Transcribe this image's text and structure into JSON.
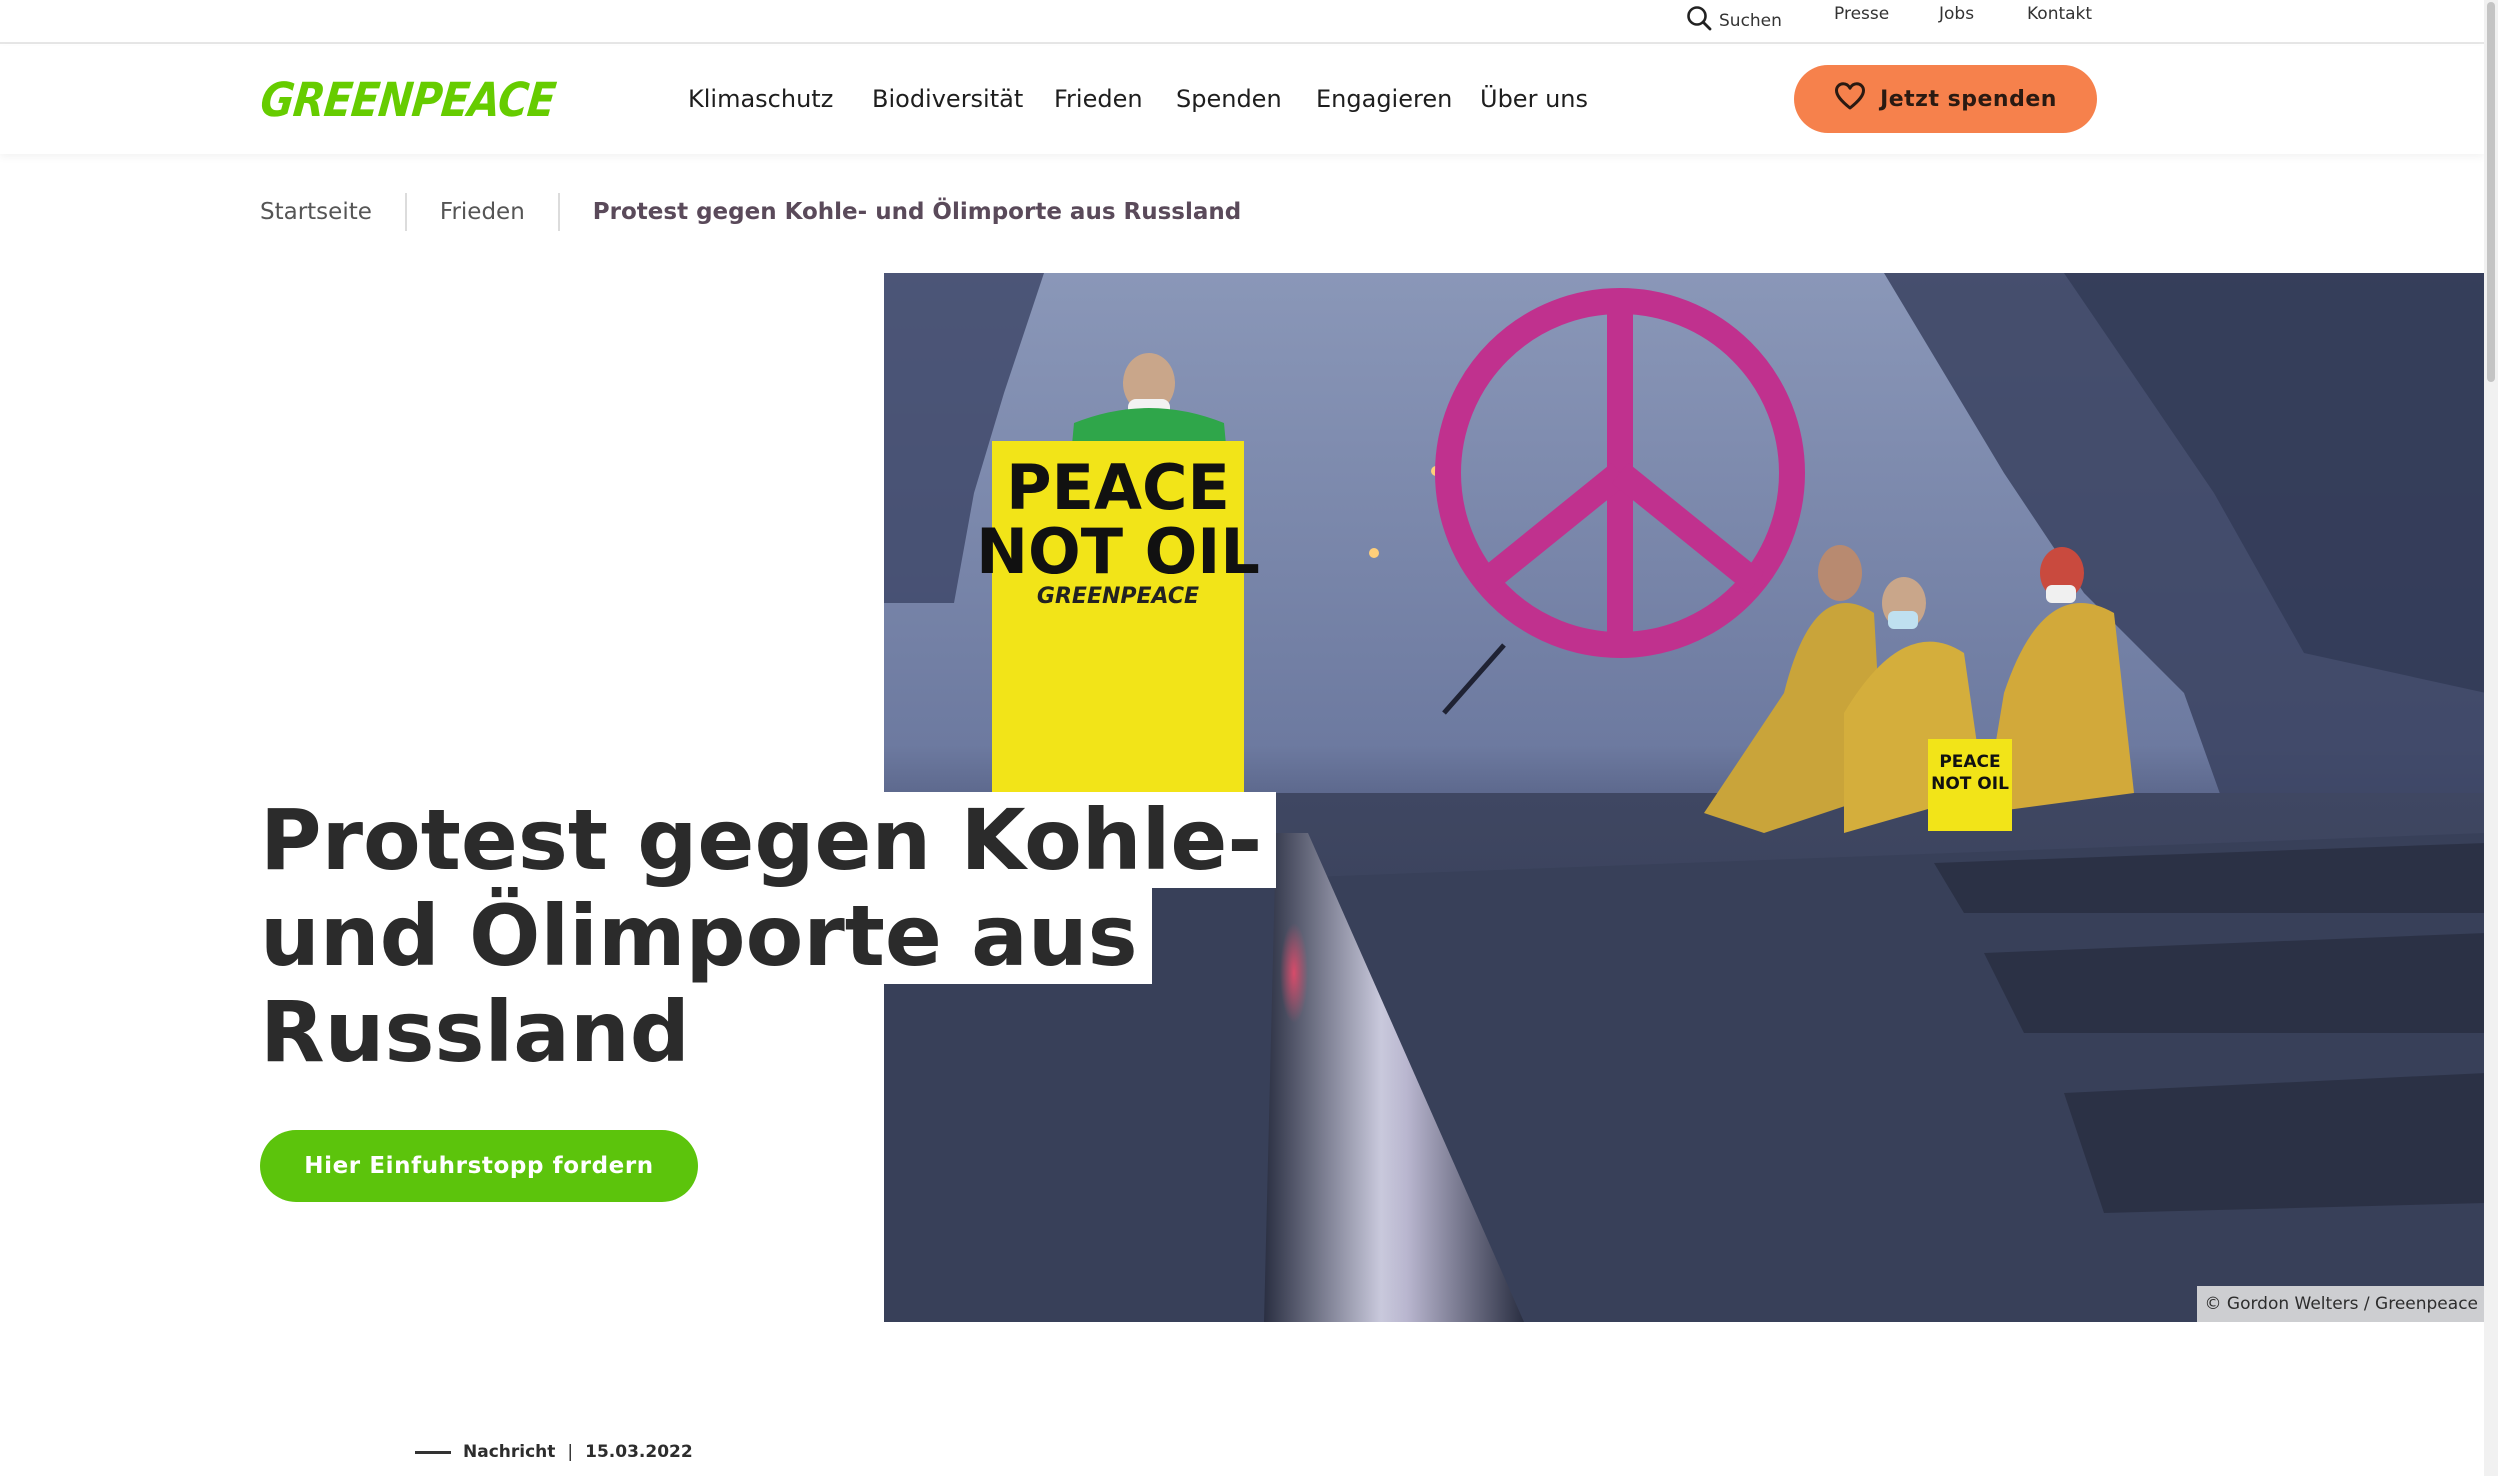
{
  "utility_bar": {
    "search_label": "Suchen",
    "presse_label": "Presse",
    "jobs_label": "Jobs",
    "kontakt_label": "Kontakt"
  },
  "header": {
    "logo_text": "GREENPEACE",
    "nav": {
      "klimaschutz": "Klimaschutz",
      "biodiversitaet": "Biodiversität",
      "frieden": "Frieden",
      "spenden": "Spenden",
      "engagieren": "Engagieren",
      "ueber_uns": "Über uns"
    },
    "donate_label": "Jetzt spenden"
  },
  "breadcrumb": {
    "home": "Startseite",
    "section": "Frieden",
    "current": "Protest gegen Kohle- und Ölimporte aus Russland"
  },
  "hero": {
    "title_lines": [
      "Protest gegen Kohle-",
      "und Ölimporte aus",
      "Russland"
    ],
    "cta_label": "Hier Einfuhrstopp fordern",
    "photo_credit": "© Gordon Welters / Greenpeace",
    "banner_main_line1": "PEACE",
    "banner_main_line2": "NOT OIL",
    "banner_main_brand": "GREENPEACE",
    "banner_small_line1": "PEACE",
    "banner_small_line2": "NOT OIL"
  },
  "meta": {
    "type": "Nachricht",
    "divider": "|",
    "date": "15.03.2022"
  },
  "colors": {
    "brand_green": "#66cc00",
    "donate_orange": "#f6814c",
    "cta_green": "#5cc40c",
    "peace_sign_magenta": "#c0318e",
    "banner_yellow": "#f2e418"
  }
}
